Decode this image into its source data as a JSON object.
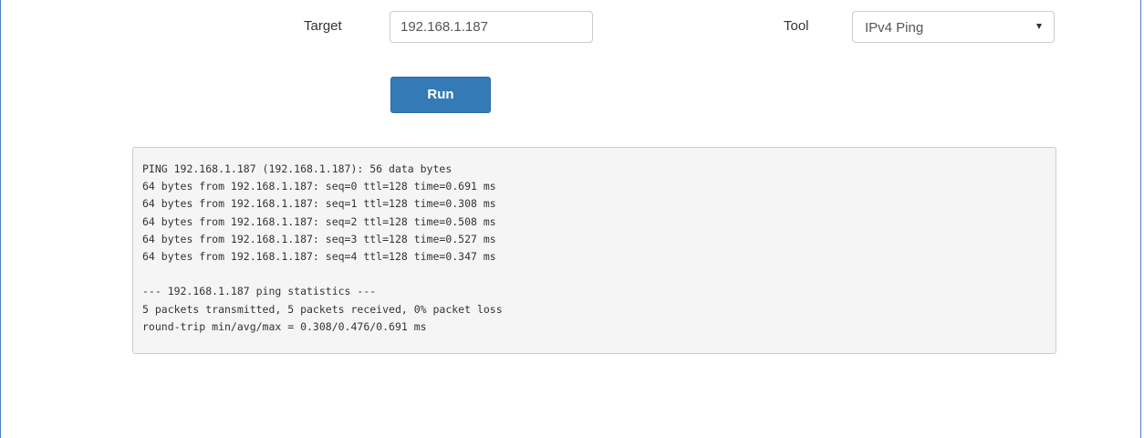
{
  "form": {
    "target_label": "Target",
    "target_value": "192.168.1.187",
    "tool_label": "Tool",
    "tool_selected": "IPv4 Ping",
    "run_label": "Run"
  },
  "output": {
    "lines": [
      "PING 192.168.1.187 (192.168.1.187): 56 data bytes",
      "64 bytes from 192.168.1.187: seq=0 ttl=128 time=0.691 ms",
      "64 bytes from 192.168.1.187: seq=1 ttl=128 time=0.308 ms",
      "64 bytes from 192.168.1.187: seq=2 ttl=128 time=0.508 ms",
      "64 bytes from 192.168.1.187: seq=3 ttl=128 time=0.527 ms",
      "64 bytes from 192.168.1.187: seq=4 ttl=128 time=0.347 ms",
      "",
      "--- 192.168.1.187 ping statistics ---",
      "5 packets transmitted, 5 packets received, 0% packet loss",
      "round-trip min/avg/max = 0.308/0.476/0.691 ms"
    ]
  },
  "colors": {
    "button_primary": "#337ab7",
    "output_background": "#f5f5f5",
    "frame_border": "#4a7fc1"
  }
}
